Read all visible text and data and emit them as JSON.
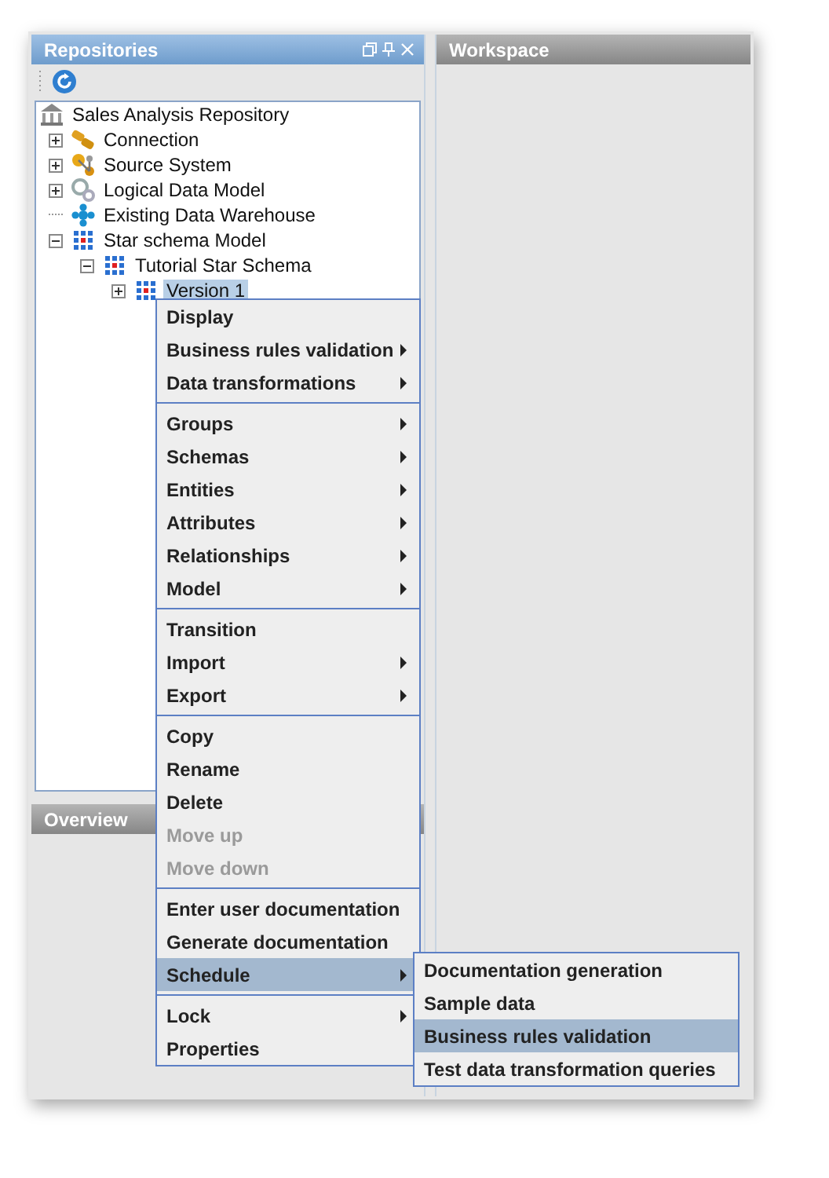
{
  "repositories": {
    "title": "Repositories",
    "tree": [
      {
        "label": "Sales Analysis Repository",
        "kind": "repository",
        "selected": false,
        "children": [
          {
            "label": "Connection",
            "kind": "connection",
            "expanded": false,
            "selected": false
          },
          {
            "label": "Source System",
            "kind": "source",
            "expanded": false,
            "selected": false
          },
          {
            "label": "Logical Data Model",
            "kind": "logical",
            "expanded": false,
            "selected": false
          },
          {
            "label": "Existing Data Warehouse",
            "kind": "warehouse",
            "selected": false
          },
          {
            "label": "Star schema Model",
            "kind": "schema",
            "expanded": true,
            "selected": false,
            "children": [
              {
                "label": "Tutorial Star Schema",
                "kind": "schema",
                "expanded": true,
                "selected": false,
                "children": [
                  {
                    "label": "Version 1",
                    "kind": "schema",
                    "expanded": false,
                    "selected": true
                  }
                ]
              }
            ]
          }
        ]
      }
    ]
  },
  "overview": {
    "title": "Overview"
  },
  "workspace": {
    "title": "Workspace"
  },
  "context_menu": {
    "groups": [
      [
        {
          "label": "Display",
          "submenu": false,
          "disabled": false,
          "selected": false
        },
        {
          "label": "Business rules validation",
          "submenu": true,
          "disabled": false,
          "selected": false
        },
        {
          "label": "Data transformations",
          "submenu": true,
          "disabled": false,
          "selected": false
        }
      ],
      [
        {
          "label": "Groups",
          "submenu": true,
          "disabled": false,
          "selected": false
        },
        {
          "label": "Schemas",
          "submenu": true,
          "disabled": false,
          "selected": false
        },
        {
          "label": "Entities",
          "submenu": true,
          "disabled": false,
          "selected": false
        },
        {
          "label": "Attributes",
          "submenu": true,
          "disabled": false,
          "selected": false
        },
        {
          "label": "Relationships",
          "submenu": true,
          "disabled": false,
          "selected": false
        },
        {
          "label": "Model",
          "submenu": true,
          "disabled": false,
          "selected": false
        }
      ],
      [
        {
          "label": "Transition",
          "submenu": false,
          "disabled": false,
          "selected": false
        },
        {
          "label": "Import",
          "submenu": true,
          "disabled": false,
          "selected": false
        },
        {
          "label": "Export",
          "submenu": true,
          "disabled": false,
          "selected": false
        }
      ],
      [
        {
          "label": "Copy",
          "submenu": false,
          "disabled": false,
          "selected": false
        },
        {
          "label": "Rename",
          "submenu": false,
          "disabled": false,
          "selected": false
        },
        {
          "label": "Delete",
          "submenu": false,
          "disabled": false,
          "selected": false
        },
        {
          "label": "Move up",
          "submenu": false,
          "disabled": true,
          "selected": false
        },
        {
          "label": "Move down",
          "submenu": false,
          "disabled": true,
          "selected": false
        }
      ],
      [
        {
          "label": "Enter user documentation",
          "submenu": false,
          "disabled": false,
          "selected": false
        },
        {
          "label": "Generate documentation",
          "submenu": false,
          "disabled": false,
          "selected": false
        },
        {
          "label": "Schedule",
          "submenu": true,
          "disabled": false,
          "selected": true
        }
      ],
      [
        {
          "label": "Lock",
          "submenu": true,
          "disabled": false,
          "selected": false
        },
        {
          "label": "Properties",
          "submenu": false,
          "disabled": false,
          "selected": false
        }
      ]
    ]
  },
  "submenu": {
    "items": [
      {
        "label": "Documentation generation",
        "selected": false
      },
      {
        "label": "Sample data",
        "selected": false
      },
      {
        "label": "Business rules validation",
        "selected": true
      },
      {
        "label": "Test data transformation queries",
        "selected": false
      }
    ]
  }
}
